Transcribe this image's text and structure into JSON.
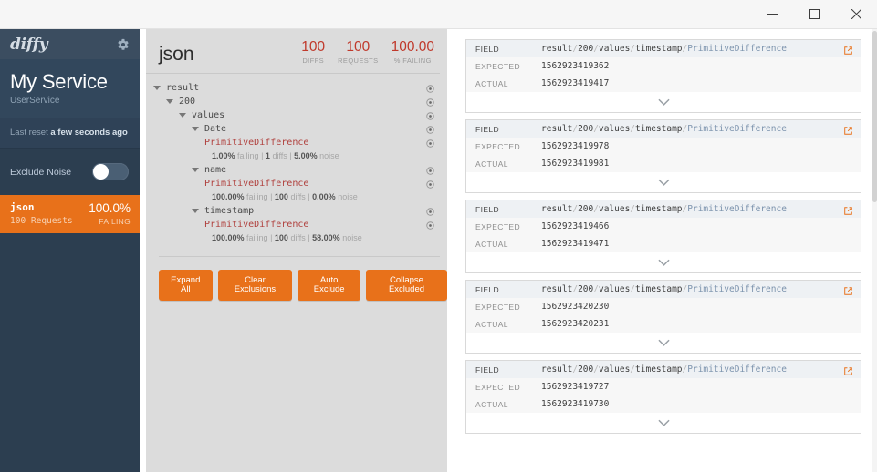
{
  "window": {
    "controls": [
      {
        "name": "minimize",
        "label": "—"
      },
      {
        "name": "maximize",
        "label": "□"
      },
      {
        "name": "close",
        "label": "×"
      }
    ]
  },
  "sidebar": {
    "logo": "diffy",
    "settings_icon": "gear-icon",
    "service_name": "My Service",
    "service_sub": "UserService",
    "last_reset_prefix": "Last reset ",
    "last_reset_value": "a few seconds ago",
    "exclude_noise_label": "Exclude Noise",
    "exclude_noise_on": false,
    "endpoints": [
      {
        "name": "json",
        "requests": "100 Requests",
        "percent": "100.0%",
        "status_label": "FAILING",
        "selected": true
      }
    ]
  },
  "middle": {
    "title": "json",
    "metrics": [
      {
        "value": "100",
        "label": "DIFFS"
      },
      {
        "value": "100",
        "label": "REQUESTS"
      },
      {
        "value": "100.00",
        "label": "% FAILING"
      }
    ],
    "tree": [
      {
        "label": "result",
        "depth": 0,
        "type": "node",
        "expanded": true
      },
      {
        "label": "200",
        "depth": 1,
        "type": "node",
        "expanded": true
      },
      {
        "label": "values",
        "depth": 2,
        "type": "node",
        "expanded": true
      },
      {
        "label": "Date",
        "depth": 3,
        "type": "node",
        "expanded": true
      },
      {
        "label": "PrimitiveDifference",
        "depth": 4,
        "type": "leaf",
        "failing": "1.00%",
        "failing_word": "failing",
        "diffs": "1",
        "diffs_word": "diffs",
        "noise": "5.00%",
        "noise_word": "noise"
      },
      {
        "label": "name",
        "depth": 3,
        "type": "node",
        "expanded": true
      },
      {
        "label": "PrimitiveDifference",
        "depth": 4,
        "type": "leaf",
        "failing": "100.00%",
        "failing_word": "failing",
        "diffs": "100",
        "diffs_word": "diffs",
        "noise": "0.00%",
        "noise_word": "noise"
      },
      {
        "label": "timestamp",
        "depth": 3,
        "type": "node",
        "expanded": true
      },
      {
        "label": "PrimitiveDifference",
        "depth": 4,
        "type": "leaf",
        "failing": "100.00%",
        "failing_word": "failing",
        "diffs": "100",
        "diffs_word": "diffs",
        "noise": "58.00%",
        "noise_word": "noise"
      }
    ],
    "buttons": [
      {
        "name": "expand-all",
        "label": "Expand All"
      },
      {
        "name": "clear-exclusions",
        "label": "Clear Exclusions"
      },
      {
        "name": "auto-exclude",
        "label": "Auto Exclude"
      },
      {
        "name": "collapse-excluded",
        "label": "Collapse Excluded"
      }
    ]
  },
  "right": {
    "labels": {
      "field": "FIELD",
      "expected": "EXPECTED",
      "actual": "ACTUAL"
    },
    "cards": [
      {
        "path_prefix": "result/200/values/timestamp/",
        "path_class": "PrimitiveDifference",
        "expected": "1562923419362",
        "actual": "1562923419417"
      },
      {
        "path_prefix": "result/200/values/timestamp/",
        "path_class": "PrimitiveDifference",
        "expected": "1562923419978",
        "actual": "1562923419981"
      },
      {
        "path_prefix": "result/200/values/timestamp/",
        "path_class": "PrimitiveDifference",
        "expected": "1562923419466",
        "actual": "1562923419471"
      },
      {
        "path_prefix": "result/200/values/timestamp/",
        "path_class": "PrimitiveDifference",
        "expected": "1562923420230",
        "actual": "1562923420231"
      },
      {
        "path_prefix": "result/200/values/timestamp/",
        "path_class": "PrimitiveDifference",
        "expected": "1562923419727",
        "actual": "1562923419730"
      }
    ]
  },
  "colors": {
    "accent_orange": "#e8711a",
    "sidebar_navy": "#2c3e50",
    "metric_red": "#c0392b",
    "leaf_red": "#b0413e",
    "class_blue": "#7c93ad"
  }
}
